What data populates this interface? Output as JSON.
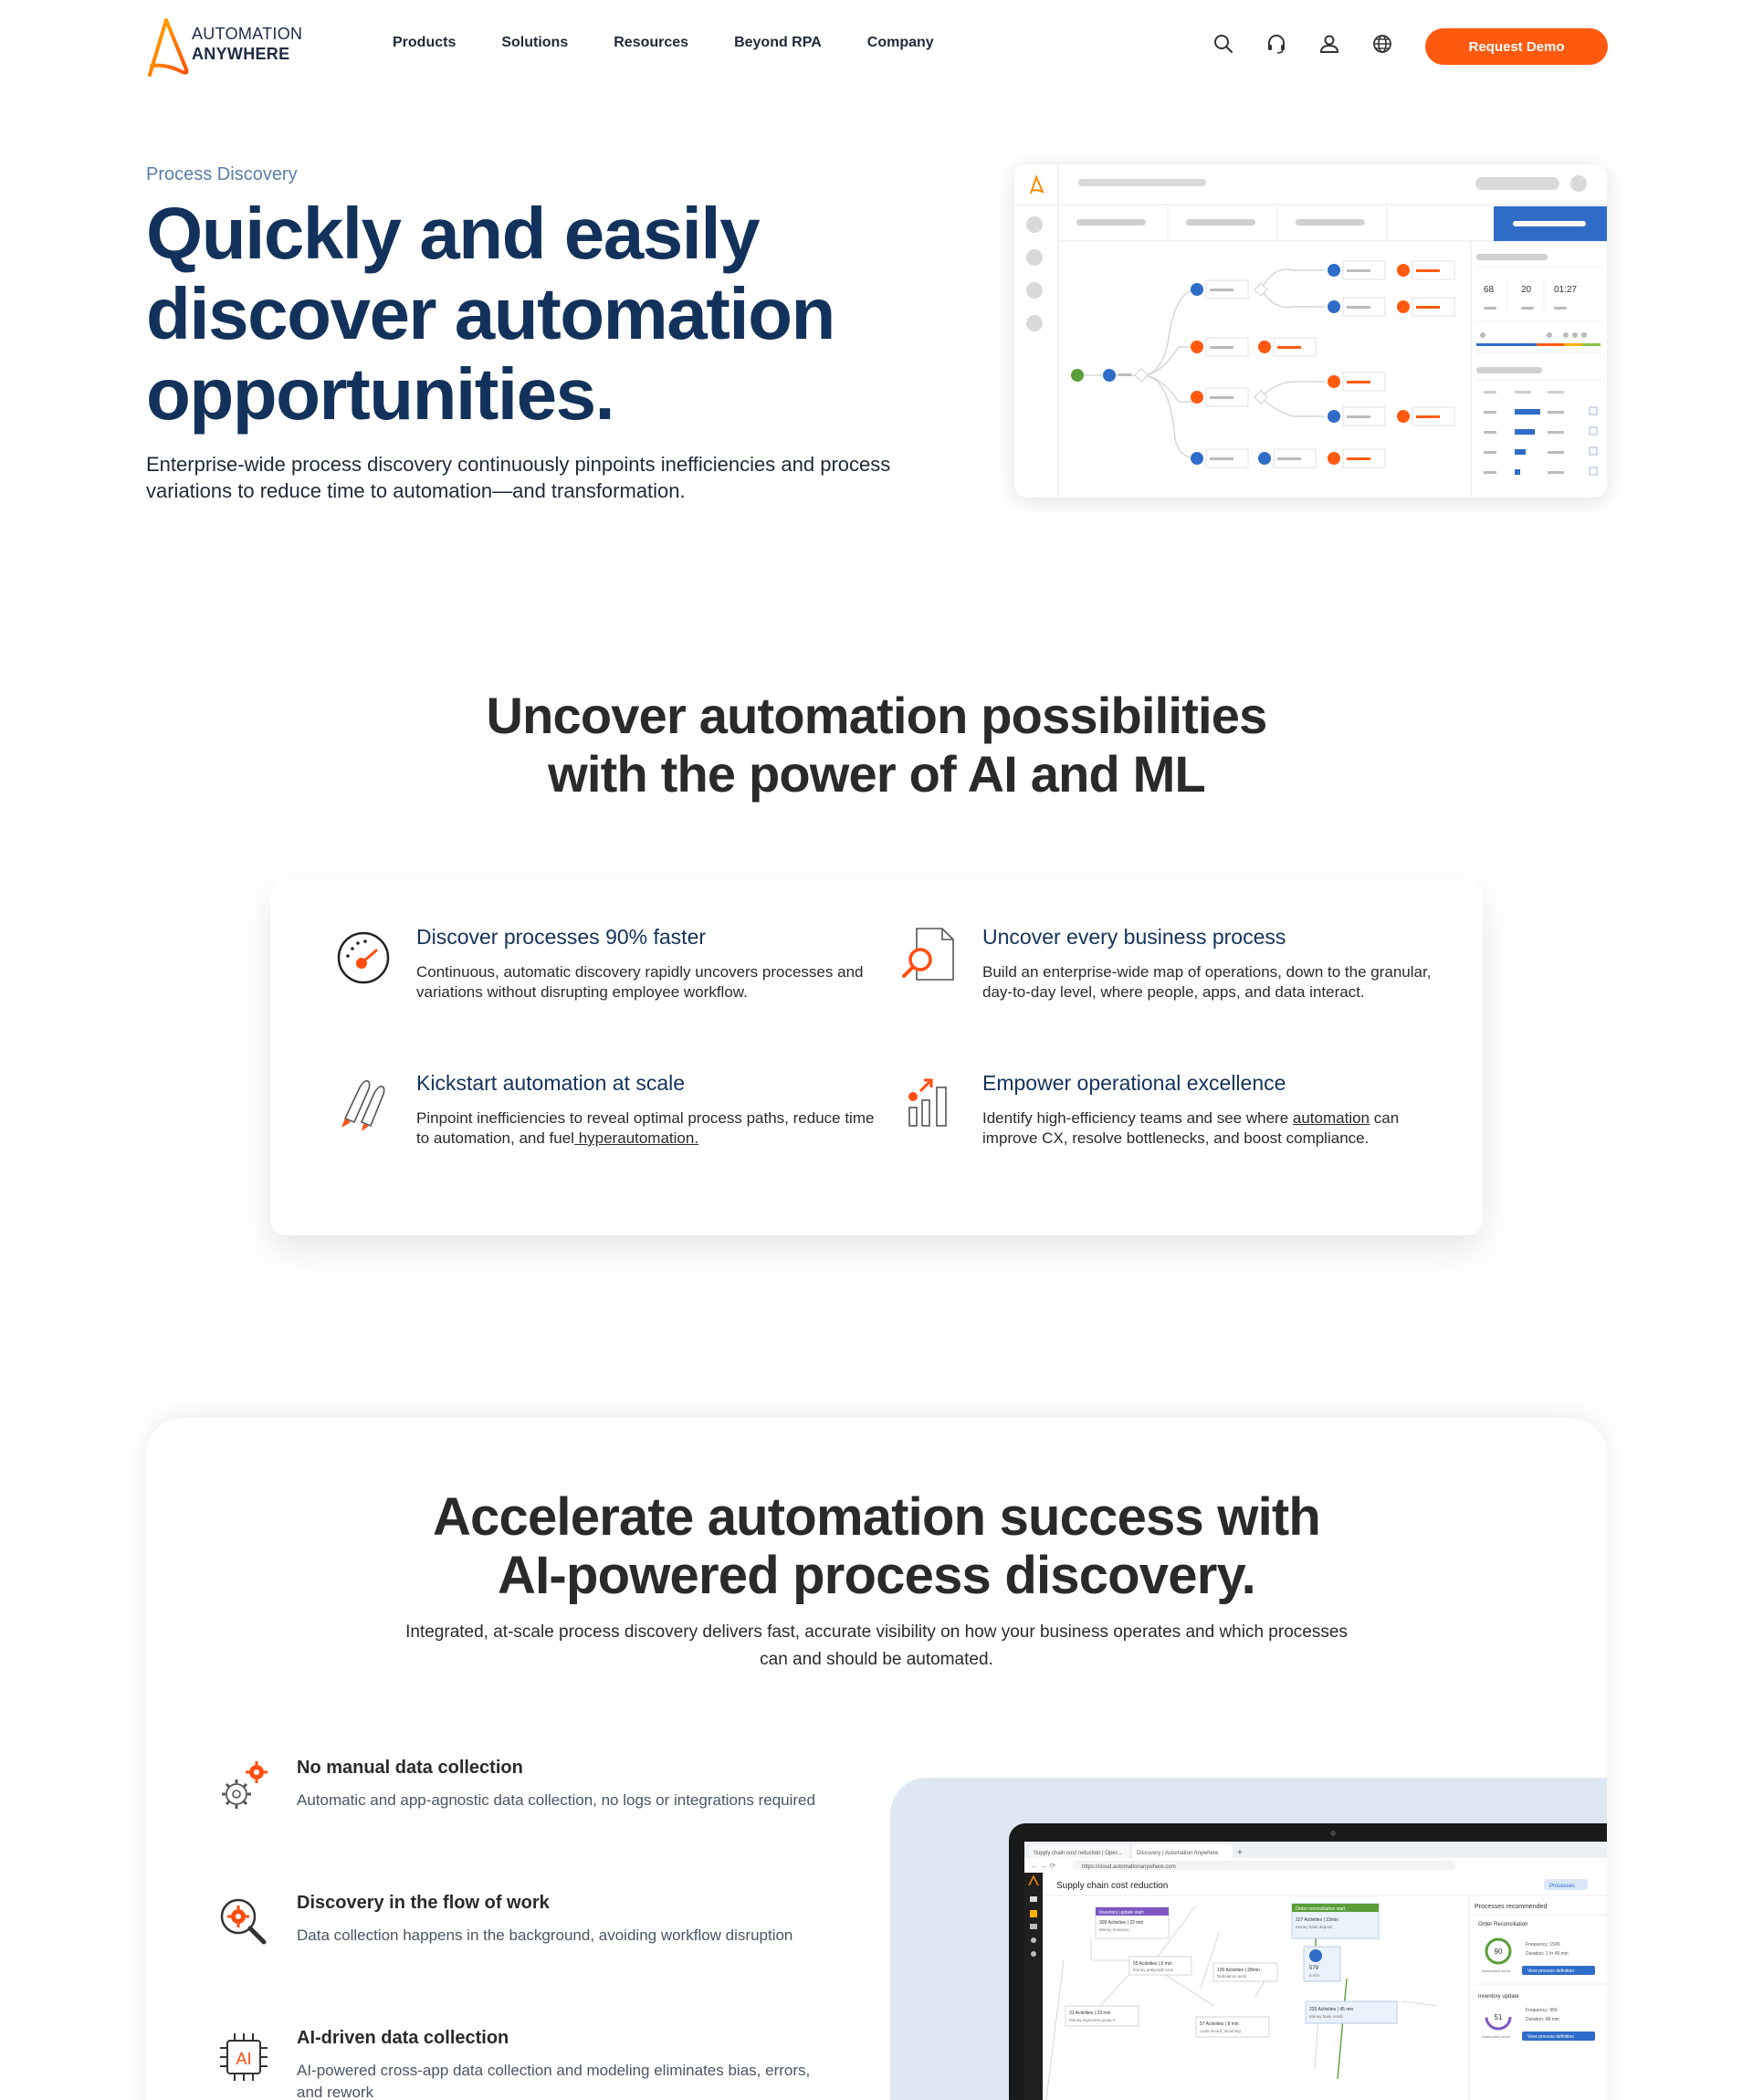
{
  "header": {
    "logo": {
      "line1": "AUTOMATION",
      "line2": "ANYWHERE"
    },
    "nav": [
      "Products",
      "Solutions",
      "Resources",
      "Beyond RPA",
      "Company"
    ],
    "icons": [
      "search-icon",
      "headset-icon",
      "user-icon",
      "globe-icon"
    ],
    "cta_label": "Request Demo"
  },
  "hero": {
    "eyebrow": "Process Discovery",
    "title": "Quickly and easily discover automation opportunities.",
    "description": "Enterprise-wide process discovery continuously pinpoints inefficiencies and process variations to reduce time to automation—and transformation.",
    "mock_stats": [
      "68",
      "20",
      "01:27"
    ]
  },
  "capabilities": {
    "title_line1": "Uncover automation possibilities",
    "title_line2": "with the power of AI and ML",
    "items": [
      {
        "title": "Discover processes 90% faster",
        "desc": "Continuous, automatic discovery rapidly uncovers processes and variations without disrupting employee workflow.",
        "icon": "speedometer-icon"
      },
      {
        "title": "Uncover every business process",
        "desc": "Build an enterprise-wide map of operations, down to the granular, day-to-day level, where people, apps, and data interact.",
        "icon": "document-search-icon"
      },
      {
        "title": "Kickstart automation at scale",
        "desc_before": "Pinpoint inefficiencies to reveal optimal process paths, reduce time to automation, and fuel",
        "desc_link": " hyperautomation.",
        "icon": "rockets-icon"
      },
      {
        "title": "Empower operational excellence",
        "desc_before": "Identify high-efficiency teams and see where ",
        "desc_link": "automation",
        "desc_after": " can improve CX, resolve bottlenecks, and boost compliance.",
        "icon": "growth-chart-icon"
      }
    ]
  },
  "accelerate": {
    "title_line1": "Accelerate automation success with",
    "title_line2": "AI-powered process discovery.",
    "description": "Integrated, at-scale process discovery delivers fast, accurate visibility on how your business operates and which processes can and should be automated.",
    "bullets": [
      {
        "title": "No manual data collection",
        "desc": "Automatic and app-agnostic data collection, no logs or integrations required",
        "icon": "gears-icon"
      },
      {
        "title": "Discovery in the flow of work",
        "desc": "Data collection happens in the background, avoiding workflow disruption",
        "icon": "magnifier-gear-icon"
      },
      {
        "title": "AI-driven data collection",
        "desc": "AI-powered cross-app data collection and modeling eliminates bias, errors, and rework",
        "icon": "ai-chip-icon"
      }
    ],
    "screenshot": {
      "tab1": "Supply chain cost reduction | Oper...",
      "tab2": "Discovery | Automation Anywhere",
      "url": "https://cloud.automationanywhere.com",
      "page_title": "Supply chain cost reduction",
      "processes_btn": "Processes",
      "panel_title": "Processes recommended",
      "rec1": {
        "name": "Order Reconciliation",
        "score": "90",
        "frequency": "Frequency: 1500",
        "duration": "Duration: 1 hr 45 min",
        "score_label": "Automation score",
        "button": "View process definition"
      },
      "rec2": {
        "name": "Inventory update",
        "score": "51",
        "frequency": "Frequency: 956",
        "duration": "Duration: 48 min",
        "score_label": "Automation score",
        "button": "View process definition"
      },
      "nodes": [
        {
          "head": "Inventory update start",
          "line1": "309 Activities | 22 min",
          "line2": "Money business"
        },
        {
          "head": "Order reconciliation start",
          "line1": "227 Activities | 23min",
          "line2": "Money bank deposit"
        },
        {
          "line1": "55 Activities | 6 min",
          "line2": "Money pettycash Arun"
        },
        {
          "line1": "100 Activities | 28min",
          "line2": "Rebalance work"
        },
        {
          "line1": "31 Activities | 23 min",
          "line2": "Money expenses group II"
        },
        {
          "line1": "57 Activities | 8 min",
          "line2": "Audit record_incoming"
        },
        {
          "line1": "220 Activities | 45 min",
          "line2": "Money bank credit"
        }
      ],
      "badge": "579",
      "badge_sub": "6 min"
    }
  },
  "colors": {
    "navy": "#13325b",
    "orange": "#ff5a10",
    "blue": "#2f6cc8",
    "green": "#5a9e3a"
  }
}
